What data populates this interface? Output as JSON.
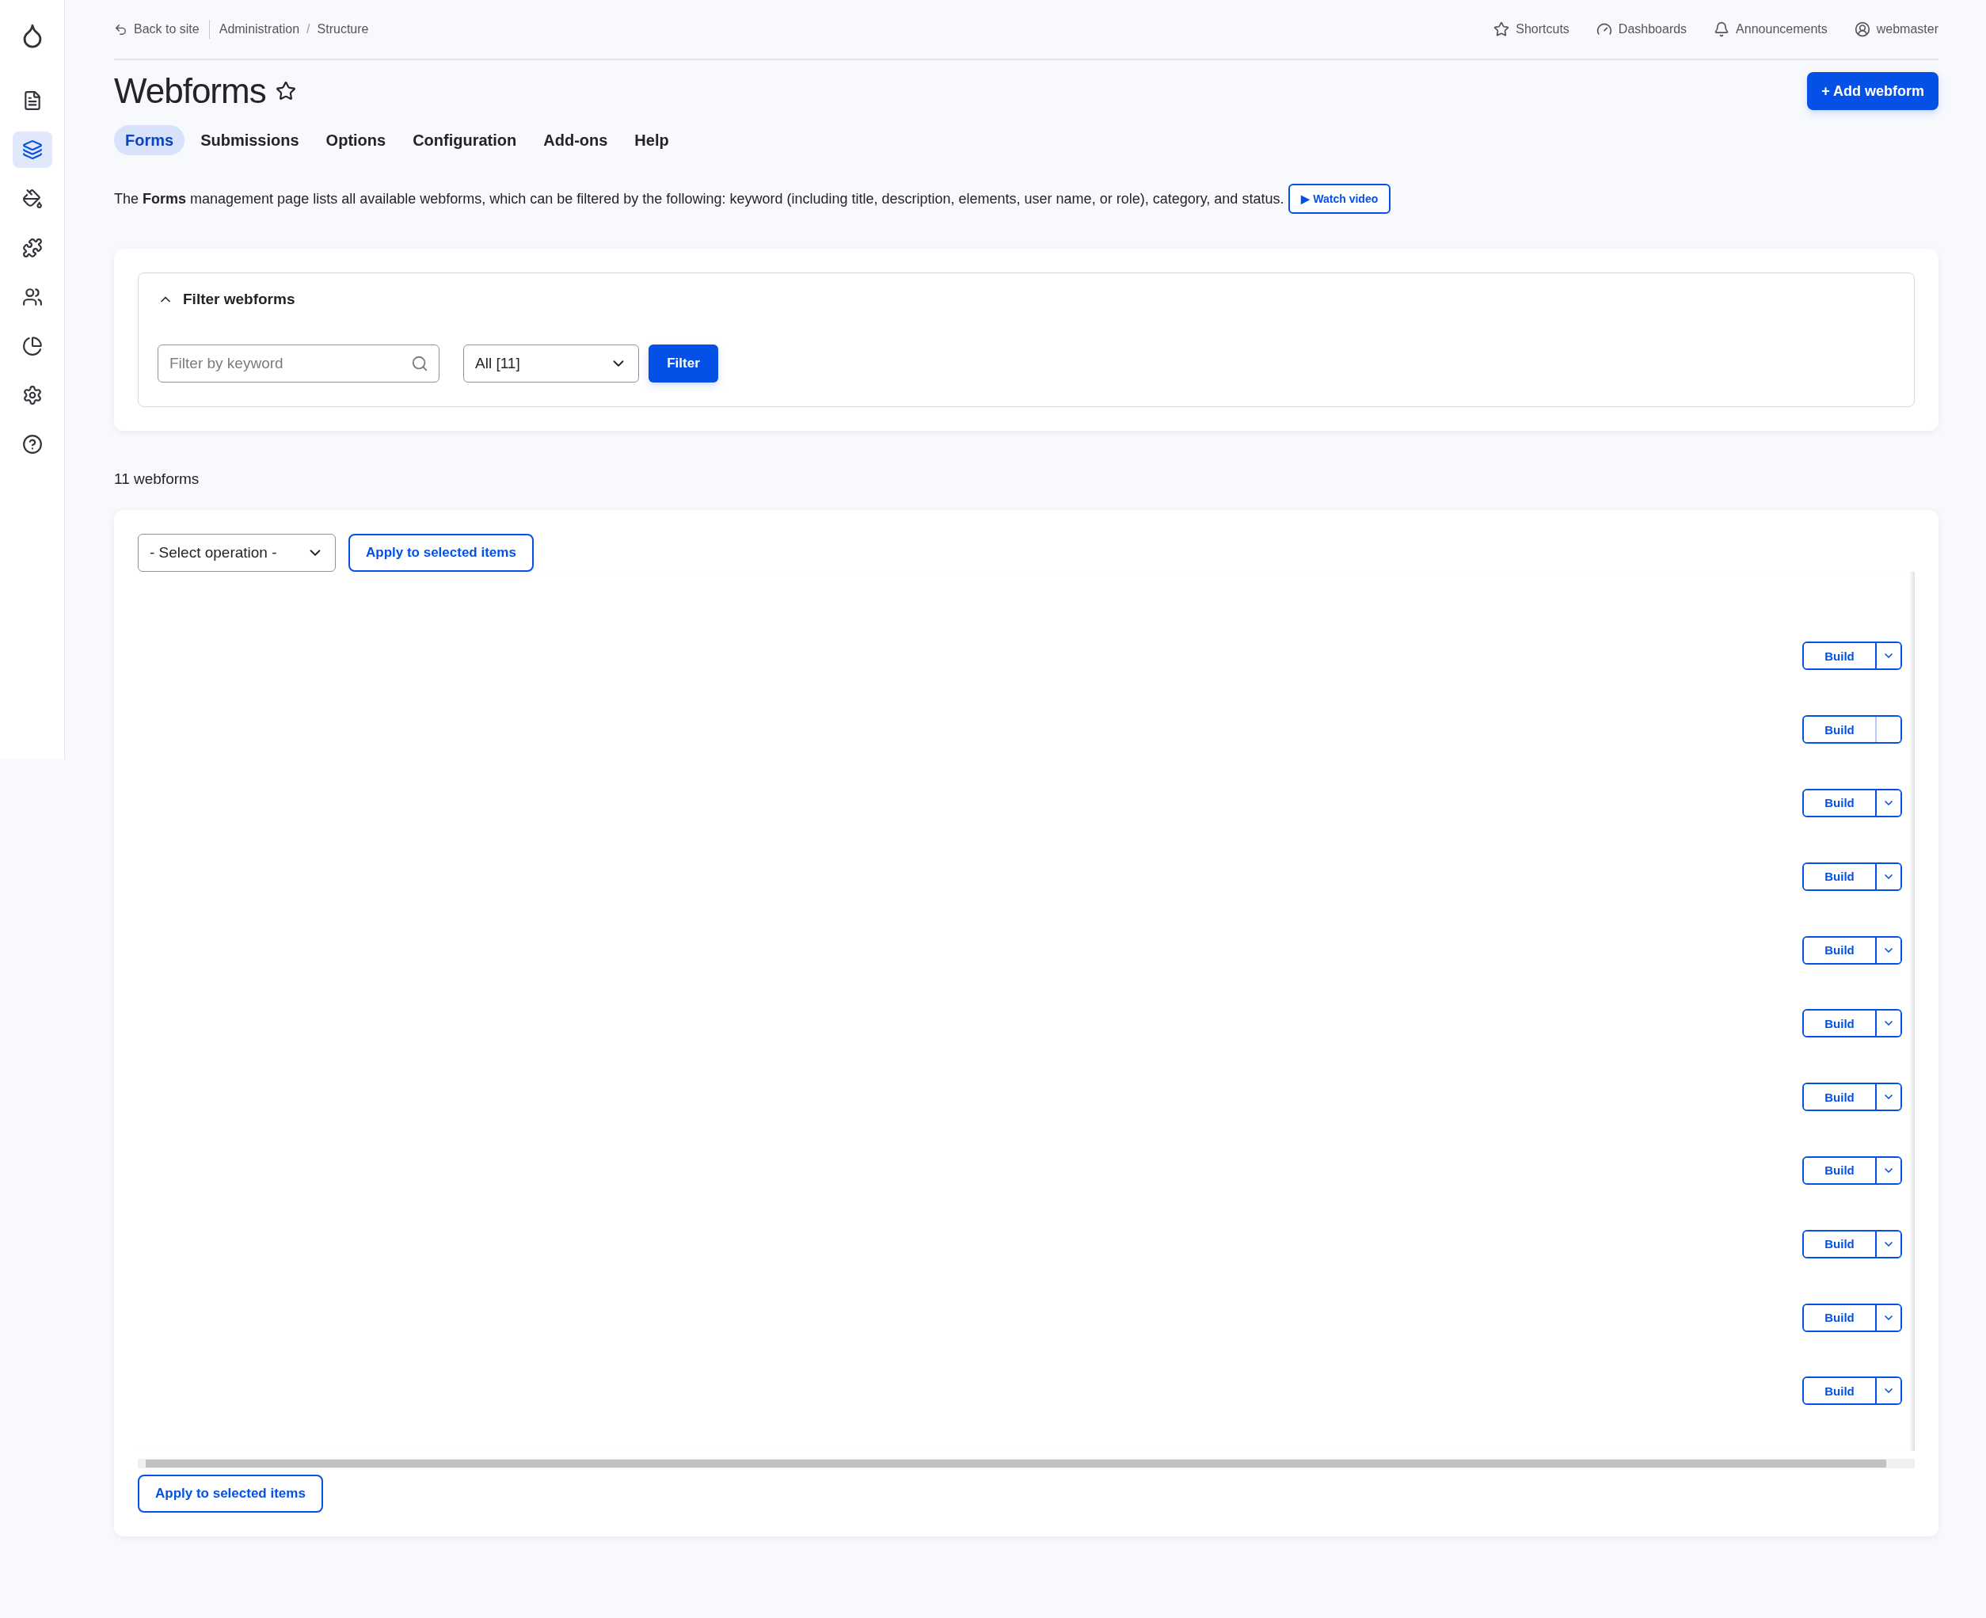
{
  "sidebar": {
    "items": [
      {
        "kind": "logo",
        "selected": false
      },
      {
        "kind": "content",
        "selected": false
      },
      {
        "kind": "structure",
        "selected": true
      },
      {
        "kind": "appearance",
        "selected": false
      },
      {
        "kind": "extend",
        "selected": false
      },
      {
        "kind": "people",
        "selected": false
      },
      {
        "kind": "reports",
        "selected": false
      },
      {
        "kind": "configuration",
        "selected": false
      },
      {
        "kind": "help",
        "selected": false
      }
    ]
  },
  "top_bar": {
    "back_link": "Back to site",
    "breadcrumbs": [
      "Administration",
      "Structure"
    ],
    "breadcrumb_separator": "/",
    "links": [
      {
        "kind": "shortcuts",
        "label": "Shortcuts"
      },
      {
        "kind": "dashboards",
        "label": "Dashboards"
      },
      {
        "kind": "announcements",
        "label": "Announcements"
      },
      {
        "kind": "user",
        "label": "webmaster"
      }
    ]
  },
  "page": {
    "title": "Webforms",
    "primary_action": "+ Add webform"
  },
  "tabs": [
    {
      "label": "Forms",
      "selected": true
    },
    {
      "label": "Submissions",
      "selected": false
    },
    {
      "label": "Options",
      "selected": false
    },
    {
      "label": "Configuration",
      "selected": false
    },
    {
      "label": "Add-ons",
      "selected": false
    },
    {
      "label": "Help",
      "selected": false
    }
  ],
  "description": {
    "text": "The **Forms** management page lists all available webforms, which can be filtered by the following: keyword (including title, description, elements, user name, or role), category, and status.",
    "video_button": "▶ Watch video"
  },
  "filter": {
    "title": "Filter webforms",
    "expanded": true,
    "keyword": {
      "placeholder": "Filter by keyword"
    },
    "state": "All [11]",
    "button": "Filter"
  },
  "count": "11 webforms",
  "bulk": {
    "operation": "- Select operation -",
    "apply_top": "Apply to selected items",
    "apply_bottom": "Apply to selected items"
  },
  "rows": [
    {
      "action": "Build",
      "has_menu": true
    },
    {
      "action": "Build",
      "has_menu": false
    },
    {
      "action": "Build",
      "has_menu": true
    },
    {
      "action": "Build",
      "has_menu": true
    },
    {
      "action": "Build",
      "has_menu": true
    },
    {
      "action": "Build",
      "has_menu": true
    },
    {
      "action": "Build",
      "has_menu": true
    },
    {
      "action": "Build",
      "has_menu": true
    },
    {
      "action": "Build",
      "has_menu": true
    },
    {
      "action": "Build",
      "has_menu": true
    },
    {
      "action": "Build",
      "has_menu": true
    }
  ]
}
